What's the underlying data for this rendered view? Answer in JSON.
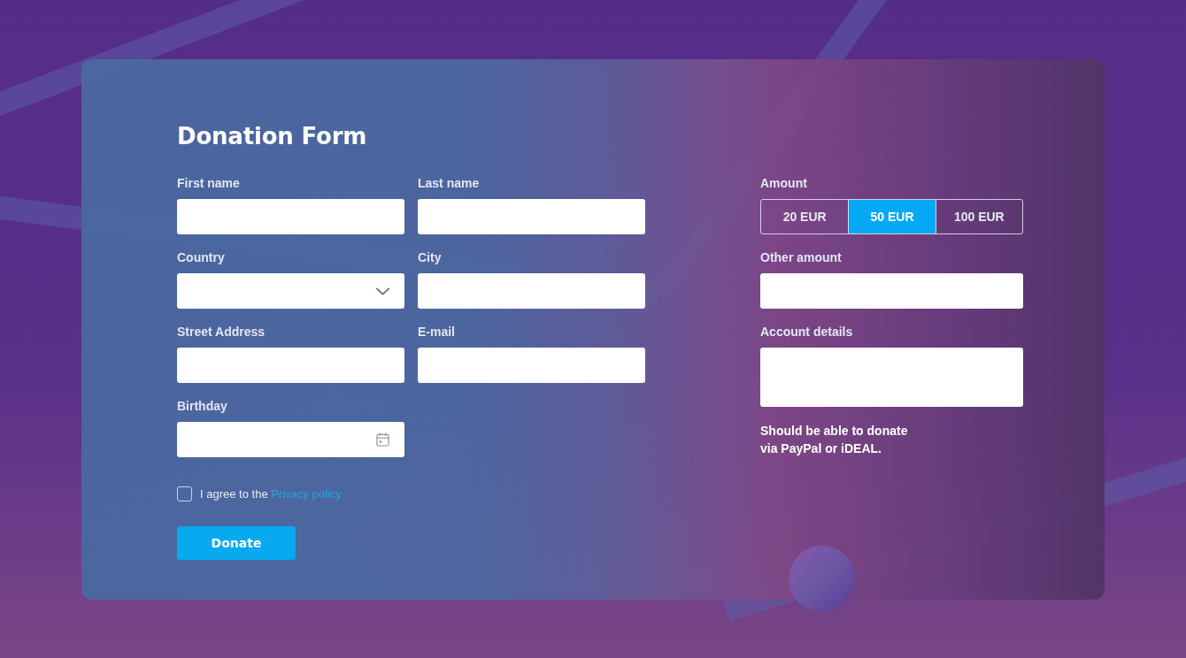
{
  "title": "Donation Form",
  "fields": [
    {
      "label": "First name",
      "kind": "text"
    },
    {
      "label": "Last name",
      "kind": "text"
    },
    {
      "label": "Country",
      "kind": "select"
    },
    {
      "label": "City",
      "kind": "text"
    },
    {
      "label": "Street Address",
      "kind": "text"
    },
    {
      "label": "E-mail",
      "kind": "text"
    },
    {
      "label": "Birthday",
      "kind": "date"
    }
  ],
  "consent": {
    "checked": false,
    "text": "I agree to the ",
    "link": "Privacy policy"
  },
  "submit": {
    "label": "Donate"
  },
  "amount": {
    "label": "Amount",
    "options": [
      {
        "label": "20 EUR",
        "selected": false
      },
      {
        "label": "50 EUR",
        "selected": true
      },
      {
        "label": "100 EUR",
        "selected": false
      }
    ]
  },
  "side_fields": [
    {
      "label": "Other amount",
      "kind": "text"
    },
    {
      "label": "Account details",
      "kind": "textarea"
    }
  ],
  "note": "Should be able to donate\nvia PayPal or iDEAL."
}
